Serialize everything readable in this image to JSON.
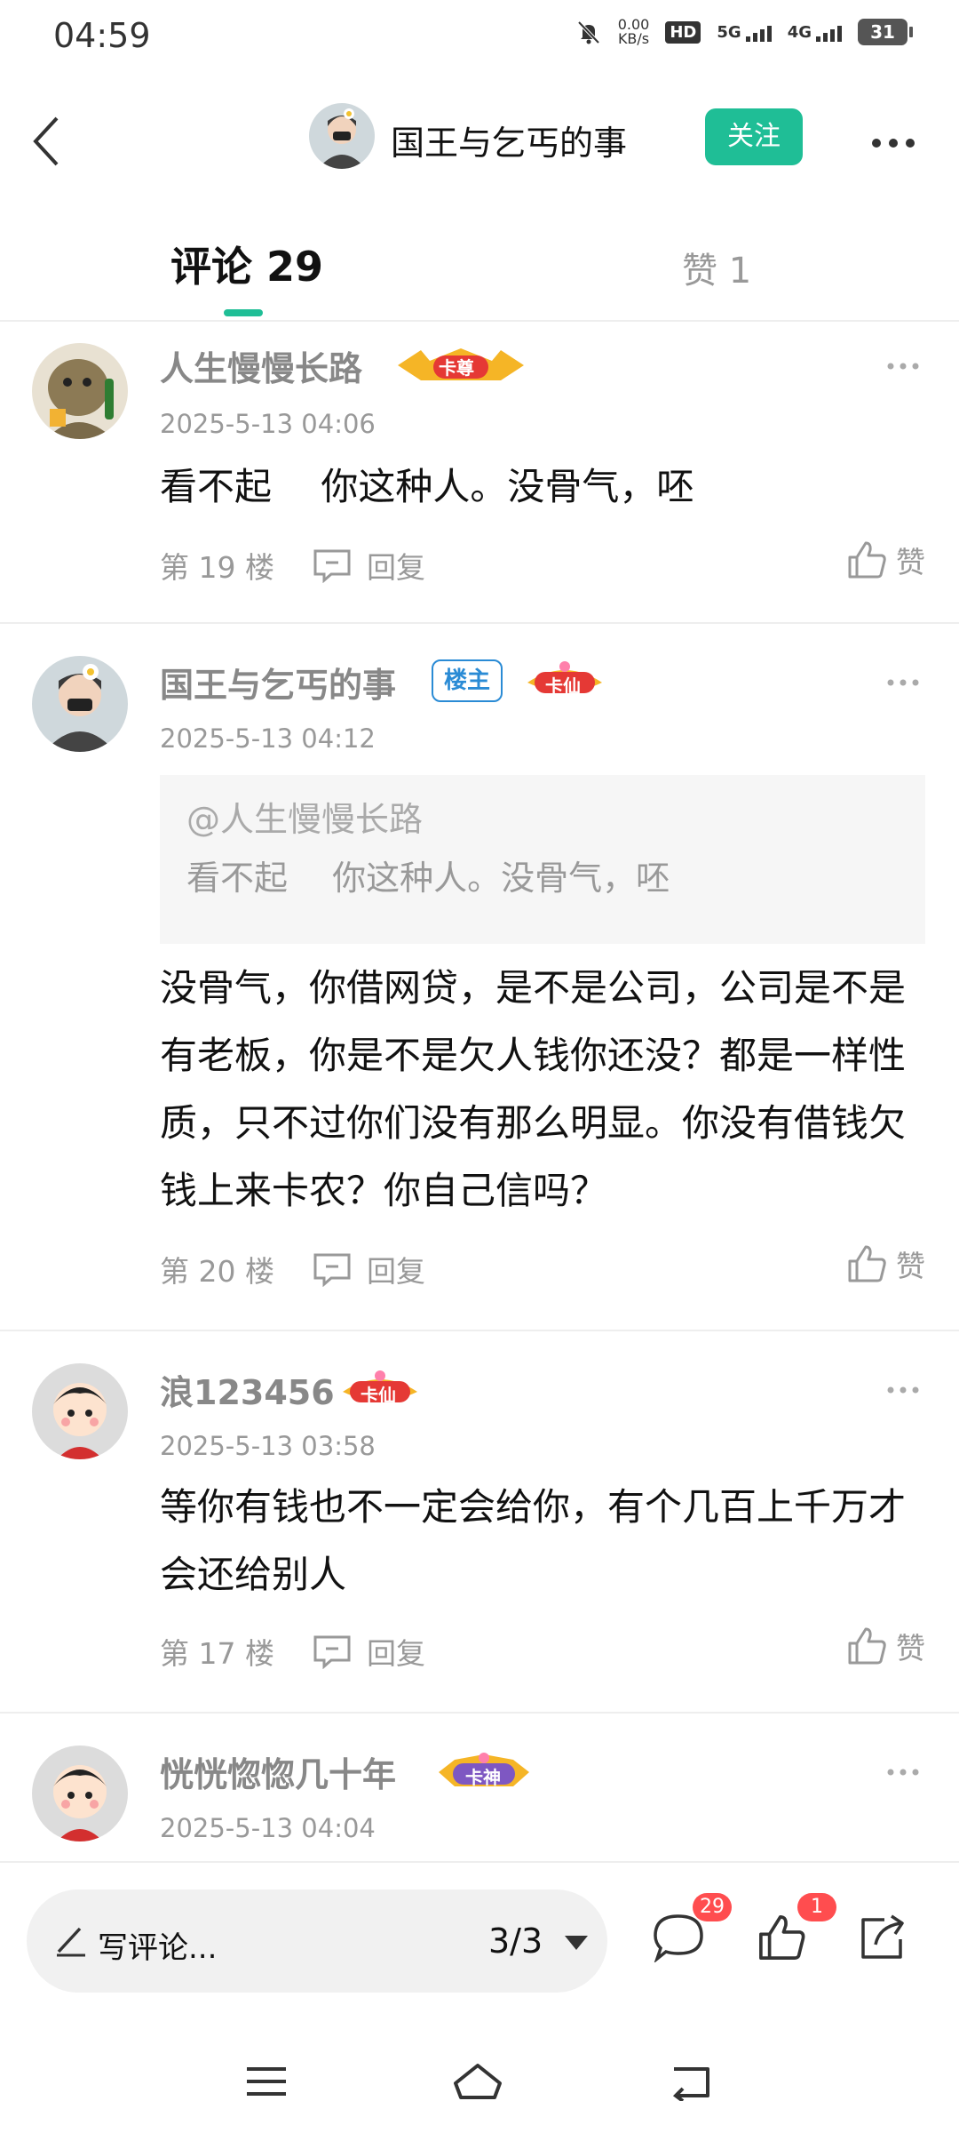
{
  "status_bar": {
    "time": "04:59",
    "net_speed_value": "0.00",
    "net_speed_unit": "KB/s",
    "hd_label": "HD",
    "sig1_label": "5G",
    "sig2_label": "4G",
    "battery": "31"
  },
  "header": {
    "title": "国王与乞丐的事",
    "follow_label": "关注"
  },
  "tabs": {
    "comments_label": "评论",
    "comments_count": "29",
    "likes_label": "赞 1"
  },
  "comments": [
    {
      "username": "人生慢慢长路",
      "badge": "卡尊",
      "date": "2025-5-13 04:06",
      "text": "看不起　 你这种人。没骨气，呸",
      "floor": "第 19 楼",
      "reply_label": "回复",
      "like_label": "赞"
    },
    {
      "username": "国王与乞丐的事",
      "owner_tag": "楼主",
      "badge": "卡仙",
      "date": "2025-5-13 04:12",
      "quote_user": "@人生慢慢长路",
      "quote_text": "看不起　 你这种人。没骨气，呸",
      "text": "没骨气，你借网贷，是不是公司，公司是不是有老板，你是不是欠人钱你还没？都是一样性质，只不过你们没有那么明显。你没有借钱欠钱上来卡农？你自己信吗？",
      "floor": "第 20 楼",
      "reply_label": "回复",
      "like_label": "赞"
    },
    {
      "username": "浪123456",
      "badge": "卡仙",
      "date": "2025-5-13 03:58",
      "text": "等你有钱也不一定会给你，有个几百上千万才会还给别人",
      "floor": "第 17 楼",
      "reply_label": "回复",
      "like_label": "赞"
    },
    {
      "username": "恍恍惚惚几十年",
      "badge": "卡神",
      "date": "2025-5-13 04:04"
    }
  ],
  "bottom_bar": {
    "write_placeholder": "写评论...",
    "page_indicator": "3/3",
    "comment_count": "29",
    "like_count": "1"
  },
  "colors": {
    "accent": "#1fbe96",
    "badge_red": "#ff4d4f",
    "owner_blue": "#2a8bd5"
  },
  "icons": [
    "back-icon",
    "more-icon",
    "reply-icon",
    "like-icon",
    "pencil-icon",
    "comment-icon",
    "share-icon",
    "menu-icon",
    "home-icon",
    "return-icon"
  ]
}
